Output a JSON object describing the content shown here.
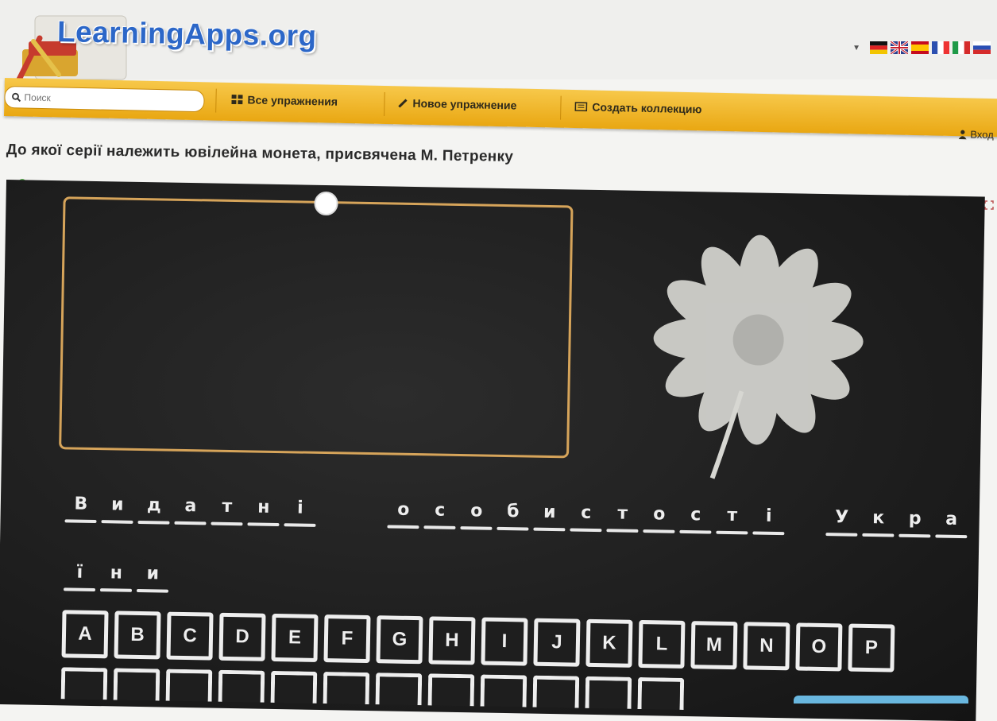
{
  "header": {
    "logo": "LearningApps.org",
    "flags": [
      "de",
      "gb",
      "es",
      "fr",
      "it",
      "ru"
    ]
  },
  "nav": {
    "search_placeholder": "Поиск",
    "all_exercises": "Все упражнения",
    "new_exercise": "Новое упражнение",
    "create_collection": "Создать коллекцию",
    "login": "Вход"
  },
  "exercise": {
    "title": "До якої серії належить ювілейна монета, присвячена М. Петренку"
  },
  "answer": {
    "words": [
      [
        "В",
        "и",
        "д",
        "а",
        "т",
        "н",
        "і"
      ],
      [
        "о",
        "с",
        "о",
        "б",
        "и",
        "с",
        "т",
        "о",
        "с",
        "т",
        "і"
      ],
      [
        "У",
        "к",
        "р",
        "а"
      ],
      [
        "ї",
        "н",
        "и"
      ]
    ]
  },
  "keyboard": {
    "row1": [
      "A",
      "B",
      "C",
      "D",
      "E",
      "F",
      "G",
      "H",
      "I",
      "J",
      "K",
      "L",
      "M",
      "N",
      "O",
      "P"
    ]
  },
  "colors": {
    "nav_bar": "#e9a712",
    "board": "#1f1f1f",
    "chalk": "#e9e9e9",
    "frame": "#d6a45a",
    "logo": "#2c67c8"
  }
}
